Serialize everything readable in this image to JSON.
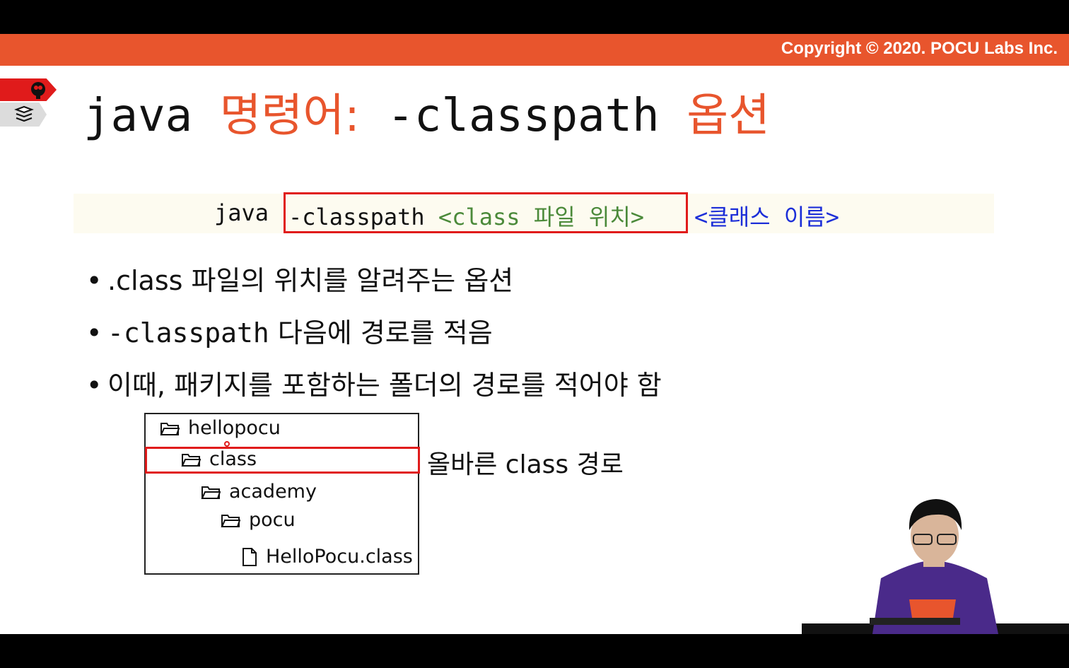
{
  "header": {
    "copyright": "Copyright © 2020. POCU Labs Inc."
  },
  "title": {
    "part1": "java ",
    "part2": "명령어:",
    "part3": " -classpath ",
    "part4": "옵션"
  },
  "code": {
    "java": "java",
    "option": "-classpath ",
    "location": "<class 파일 위치>",
    "classname": "<클래스 이름>"
  },
  "bullets": [
    {
      "text": ".class 파일의 위치를 알려주는 옵션"
    },
    {
      "code": "-classpath",
      "text": " 다음에 경로를 적음"
    },
    {
      "text": "이때, 패키지를 포함하는 폴더의 경로를 적어야 함"
    }
  ],
  "tree": {
    "items": [
      {
        "label": "hellopocu",
        "icon": "folder-icon"
      },
      {
        "label": "class",
        "icon": "folder-icon"
      },
      {
        "label": "academy",
        "icon": "folder-icon"
      },
      {
        "label": "pocu",
        "icon": "folder-icon"
      },
      {
        "label": "HelloPocu.class",
        "icon": "file-icon"
      }
    ],
    "note": "올바른 class 경로"
  },
  "colors": {
    "accent": "#e8552d",
    "highlight": "#e01b1b",
    "code_green": "#4b8a3a",
    "code_blue": "#1c2ed8"
  }
}
